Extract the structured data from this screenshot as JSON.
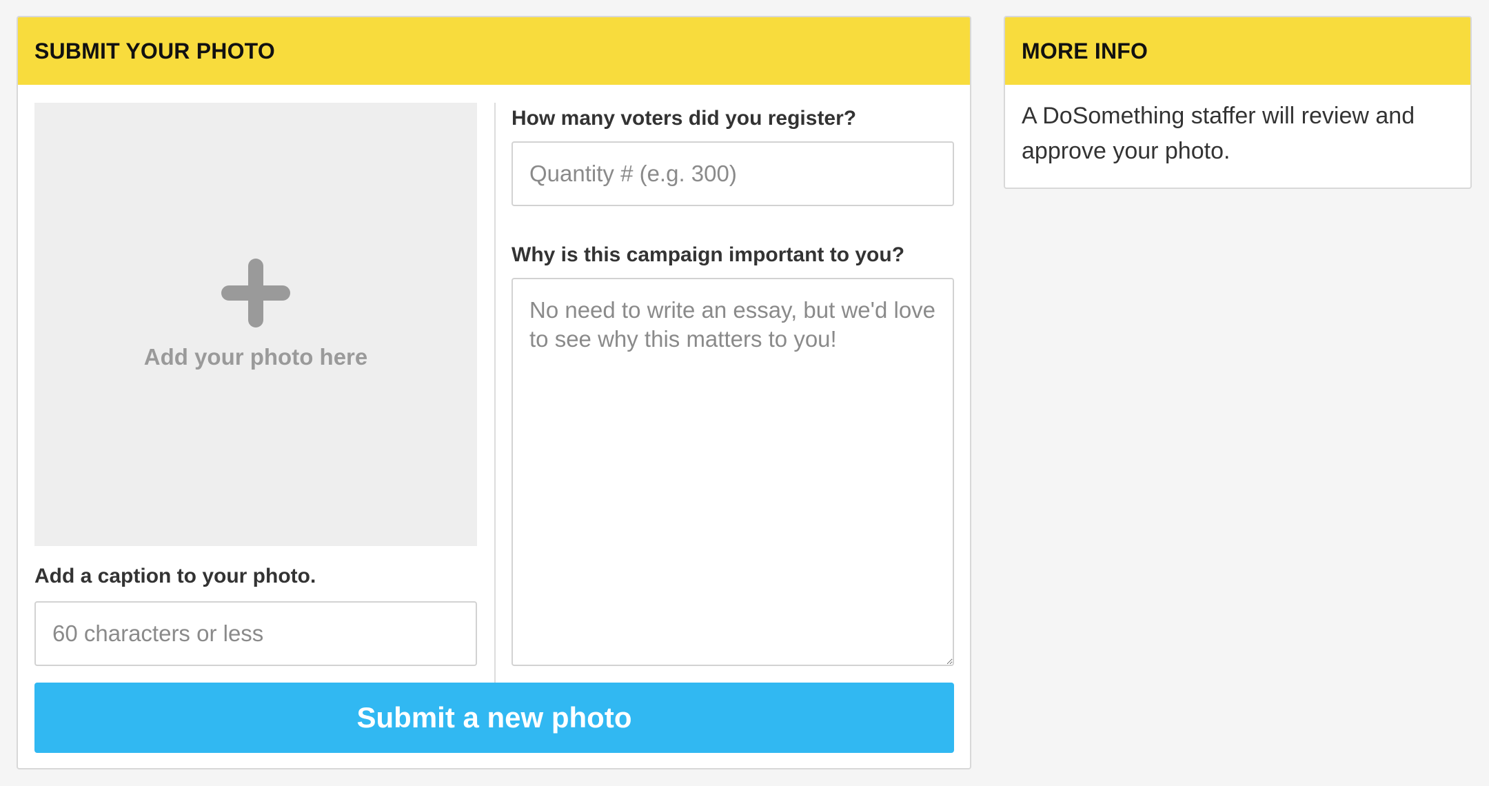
{
  "submit_card": {
    "title": "SUBMIT YOUR PHOTO",
    "upload": {
      "icon": "plus-icon",
      "label": "Add your photo here"
    },
    "caption": {
      "label": "Add a caption to your photo.",
      "value": "",
      "placeholder": "60 characters or less"
    },
    "quantity": {
      "label": "How many voters did you register?",
      "value": "",
      "placeholder": "Quantity # (e.g. 300)"
    },
    "why": {
      "label": "Why is this campaign important to you?",
      "value": "",
      "placeholder": "No need to write an essay, but we'd love to see why this matters to you!"
    },
    "submit_label": "Submit a new photo"
  },
  "info_card": {
    "title": "MORE INFO",
    "body": "A DoSomething staffer will review and approve your photo."
  },
  "colors": {
    "header_bg": "#f8dc3d",
    "button_bg": "#31b8f2",
    "page_bg": "#f5f5f5",
    "upload_bg": "#eeeeee"
  }
}
